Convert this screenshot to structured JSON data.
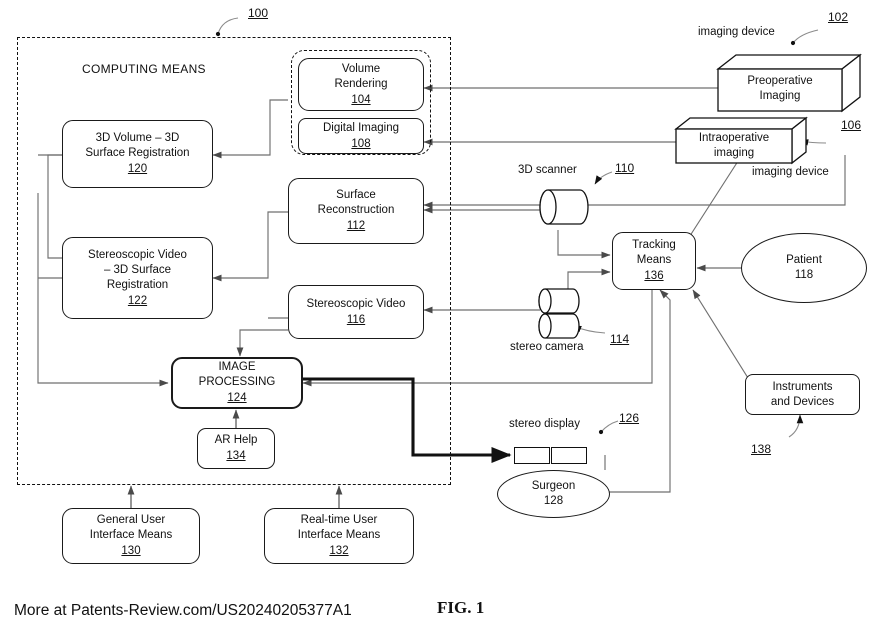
{
  "figure": {
    "number": "FIG. 1",
    "system_ref": "100",
    "boundary_title": "COMPUTING MEANS",
    "footer": "More at Patents-Review.com/US20240205377A1"
  },
  "nodes": {
    "volume_rendering": {
      "line1": "Volume",
      "line2": "Rendering",
      "ref": "104"
    },
    "digital_imaging": {
      "line1": "Digital Imaging",
      "ref": "108"
    },
    "surface_reconstruction": {
      "line1": "Surface",
      "line2": "Reconstruction",
      "ref": "112"
    },
    "stereoscopic_video": {
      "line1": "Stereoscopic Video",
      "ref": "116"
    },
    "volume_surface_registration": {
      "line1": "3D Volume – 3D",
      "line2": "Surface Registration",
      "ref": "120"
    },
    "video_surface_registration": {
      "line1": "Stereoscopic Video",
      "line2": "– 3D Surface",
      "line3": "Registration",
      "ref": "122"
    },
    "image_processing": {
      "line1": "IMAGE",
      "line2": "PROCESSING",
      "ref": "124"
    },
    "ar_help": {
      "line1": "AR Help",
      "ref": "134"
    },
    "general_ui": {
      "line1": "General User",
      "line2": "Interface Means",
      "ref": "130"
    },
    "realtime_ui": {
      "line1": "Real-time User",
      "line2": "Interface Means",
      "ref": "132"
    },
    "tracking_means": {
      "line1": "Tracking",
      "line2": "Means",
      "ref": "136"
    },
    "instruments": {
      "line1": "Instruments",
      "line2": "and Devices",
      "ref": "138"
    },
    "patient": {
      "line1": "Patient",
      "ref": "118"
    },
    "surgeon": {
      "line1": "Surgeon",
      "ref": "128"
    },
    "preoperative_imaging": {
      "line1": "Preoperative",
      "line2": "Imaging",
      "ref": "102",
      "caption": "imaging device"
    },
    "intraoperative_imaging": {
      "line1": "Intraoperative",
      "line2": "imaging",
      "ref": "106",
      "caption": "imaging device"
    },
    "scanner_3d": {
      "caption": "3D scanner",
      "ref": "110"
    },
    "stereo_camera": {
      "caption": "stereo camera",
      "ref": "114"
    },
    "stereo_display": {
      "caption": "stereo display",
      "ref": "126"
    }
  },
  "colors": {
    "ink": "#111111",
    "line": "#6f6f6f",
    "bold_line": "#111111",
    "paper": "#ffffff"
  }
}
